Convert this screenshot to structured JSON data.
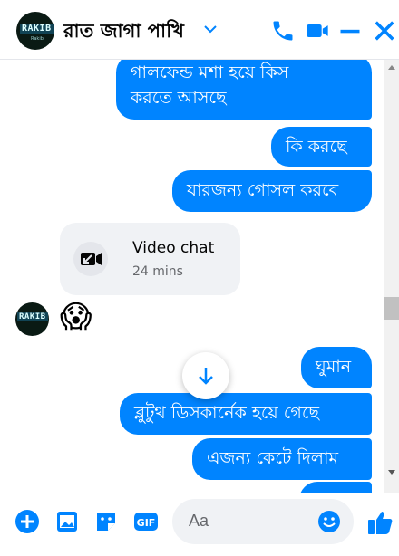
{
  "header": {
    "title": "রাত জাগা পাখি",
    "avatar_text": "RAKIB",
    "avatar_sub": "Rakib"
  },
  "messages": {
    "m1_line1": "গালফেন্ড মশা হয়ে কিস",
    "m1_line2": "করতে আসছে",
    "m2": "কি করছে",
    "m3": "যারজন্য গোসল করবে",
    "video_title": "Video chat",
    "video_duration": "24 mins",
    "reaction_emoji": "😱",
    "m4": "ঘুমান",
    "m5": "ব্লুটুথ ডিসকার্নেক হয়ে গেছে",
    "m6": "এজন্য কেটে দিলাম"
  },
  "composer": {
    "placeholder": "Aa"
  },
  "colors": {
    "accent": "#0084ff"
  }
}
